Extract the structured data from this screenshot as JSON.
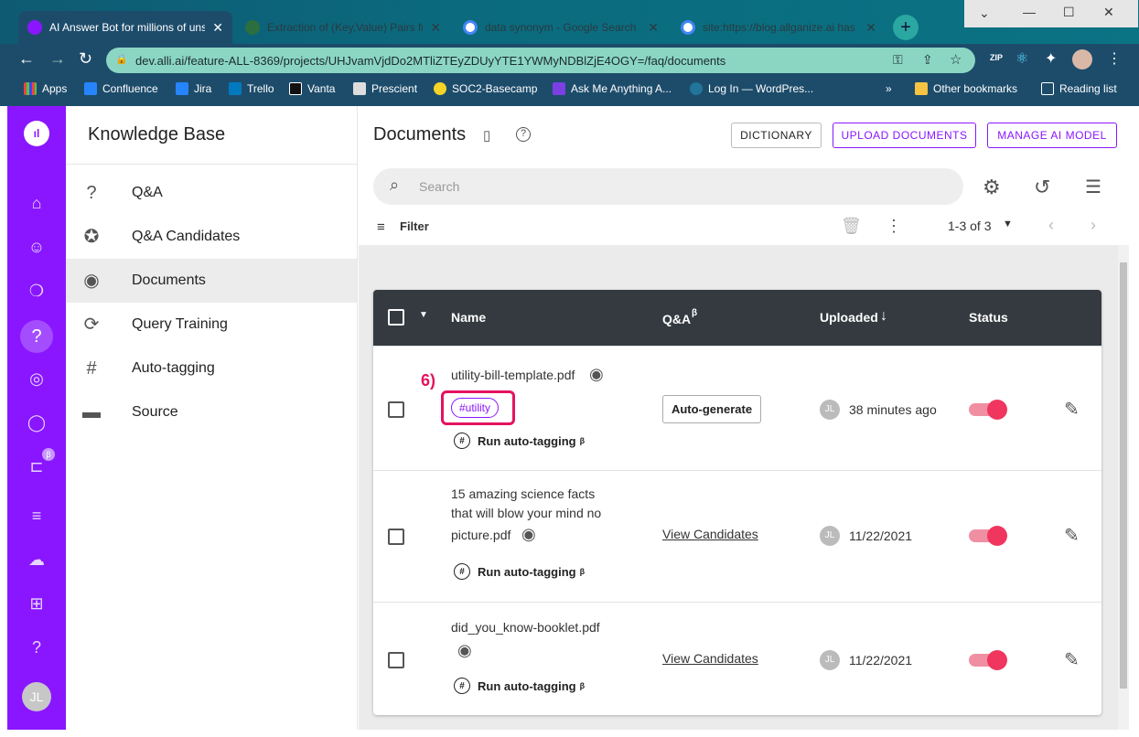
{
  "browser": {
    "tabs": [
      {
        "title": "AI Answer Bot for millions of uns",
        "active": true
      },
      {
        "title": "Extraction of (Key,Value) Pairs fr",
        "active": false
      },
      {
        "title": "data synonym - Google Search",
        "active": false
      },
      {
        "title": "site:https://blog.allganize.ai has",
        "active": false
      }
    ],
    "url": "dev.alli.ai/feature-ALL-8369/projects/UHJvamVjdDo2MTliZTEyZDUyYTE1YWMyNDBlZjE4OGY=/faq/documents",
    "bookmarks": [
      "Apps",
      "Confluence",
      "Jira",
      "Trello",
      "Vanta",
      "Prescient",
      "SOC2-Basecamp",
      "Ask Me Anything A...",
      "Log In — WordPres..."
    ],
    "other_bookmarks": "Other bookmarks",
    "reading_list": "Reading list",
    "overflow": "»"
  },
  "rail": {
    "avatar_initials": "JL",
    "beta": "β"
  },
  "sidebar": {
    "title": "Knowledge Base",
    "items": [
      {
        "label": "Q&A",
        "icon": "question-circle-icon"
      },
      {
        "label": "Q&A Candidates",
        "icon": "star-bubble-icon"
      },
      {
        "label": "Documents",
        "icon": "eye-icon"
      },
      {
        "label": "Query Training",
        "icon": "training-icon"
      },
      {
        "label": "Auto-tagging",
        "icon": "hashtag-icon"
      },
      {
        "label": "Source",
        "icon": "folder-icon"
      }
    ]
  },
  "header": {
    "title": "Documents",
    "dictionary": "DICTIONARY",
    "upload": "UPLOAD DOCUMENTS",
    "manage": "MANAGE AI MODEL"
  },
  "search": {
    "placeholder": "Search"
  },
  "toolbar": {
    "filter": "Filter",
    "pagination": "1-3 of 3"
  },
  "table": {
    "columns": {
      "name": "Name",
      "qa": "Q&A",
      "qa_beta": "β",
      "uploaded": "Uploaded",
      "status": "Status"
    },
    "run_label": "Run auto-tagging",
    "beta": "β",
    "rows": [
      {
        "name": "utility-bill-template.pdf",
        "tag": "#utility",
        "qa": "Auto-generate",
        "initials": "JL",
        "uploaded": "38 minutes ago"
      },
      {
        "name_line1": "15 amazing science facts",
        "name_line2": "that will blow your mind no",
        "name_line3": "picture.pdf",
        "qa": "View Candidates",
        "initials": "JL",
        "uploaded": "11/22/2021"
      },
      {
        "name": "did_you_know-booklet.pdf",
        "qa": "View Candidates",
        "initials": "JL",
        "uploaded": "11/22/2021"
      }
    ]
  },
  "annotation": {
    "label": "6)"
  },
  "colors": {
    "brand": "#8a16ff",
    "toggle": "#f0365e",
    "annotation": "#e4135f"
  }
}
